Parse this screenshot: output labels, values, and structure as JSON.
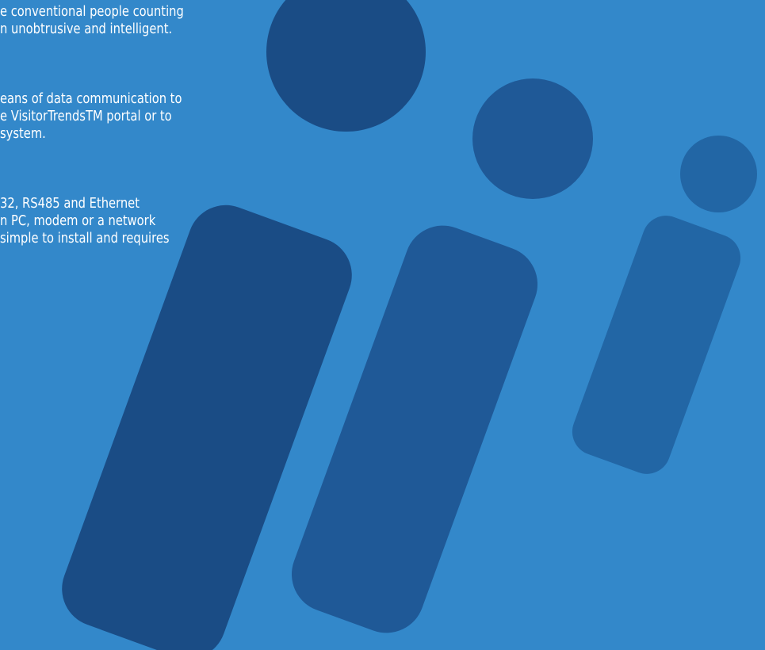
{
  "colors": {
    "background": "#3388CA",
    "figure_large": "#1A4C85",
    "figure_medium": "#1F5997",
    "figure_small": "#2266A5",
    "text": "#FFFFFF"
  },
  "paragraphs": [
    {
      "lines": [
        "e conventional people counting",
        "n unobtrusive and intelligent."
      ]
    },
    {
      "lines": [
        "eans of data communication to",
        "e VisitorTrendsTM portal or to",
        "system."
      ]
    },
    {
      "lines": [
        "32, RS485 and Ethernet",
        "n PC, modem or a network",
        "simple to install and requires"
      ]
    }
  ]
}
